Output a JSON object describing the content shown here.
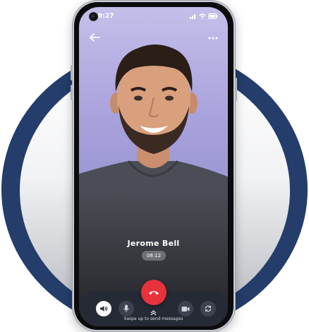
{
  "status_bar": {
    "time": "9:27"
  },
  "call": {
    "caller_name": "Jerome Bell",
    "duration": "08:12"
  },
  "controls": {
    "speaker_icon": "speaker-icon",
    "mic_icon": "microphone-icon",
    "end_call_icon": "phone-hangup-icon",
    "video_icon": "video-camera-icon",
    "switch_icon": "switch-camera-icon"
  },
  "swipe_hint": "Swipe up to send messages",
  "colors": {
    "ring": "#243d6b",
    "end_call": "#e8323c",
    "screen_background": "#a8a2dc",
    "tray": "#262a34"
  }
}
